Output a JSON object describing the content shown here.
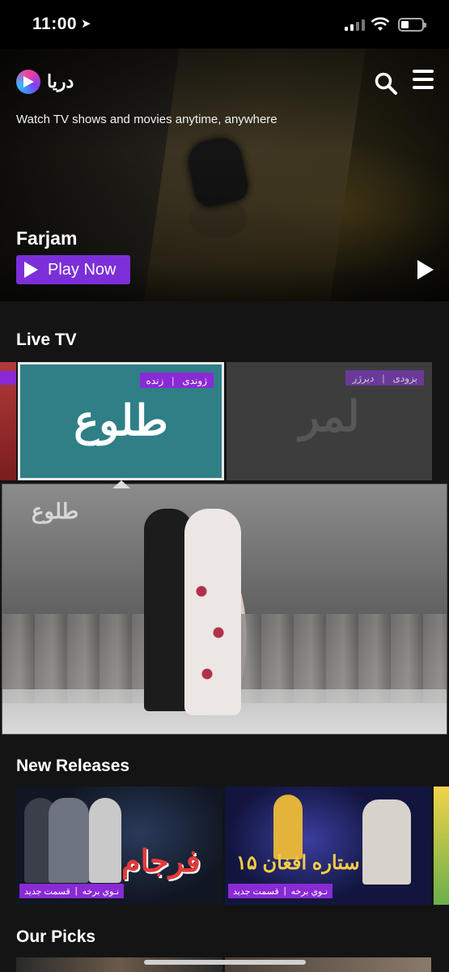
{
  "status_bar": {
    "time": "11:00"
  },
  "app": {
    "logo_text": "دریا",
    "tagline": "Watch TV shows and movies anytime, anywhere"
  },
  "hero": {
    "title": "Farjam",
    "play_label": "Play Now"
  },
  "sections": {
    "live_tv": "Live TV",
    "new_releases": "New Releases",
    "our_picks": "Our Picks"
  },
  "live_channels": [
    {
      "logo": "طلوع",
      "tag_left": "ژوندی",
      "tag_right": "زنده"
    },
    {
      "logo": "لمر",
      "tag_left": "بزودی",
      "tag_right": "دیرژر"
    }
  ],
  "live_preview": {
    "watermark": "طلوع"
  },
  "new_releases": [
    {
      "title_art": "فرجام",
      "tag_left": "قسمت جدید",
      "tag_right": "نـوي برخه"
    },
    {
      "title_art": "ستاره افغان ۱۵",
      "tag_left": "قسمت جدید",
      "tag_right": "نـوي برخه"
    }
  ],
  "colors": {
    "accent": "#7c2fd9",
    "tag": "#8a2ad6",
    "background": "#141414"
  }
}
